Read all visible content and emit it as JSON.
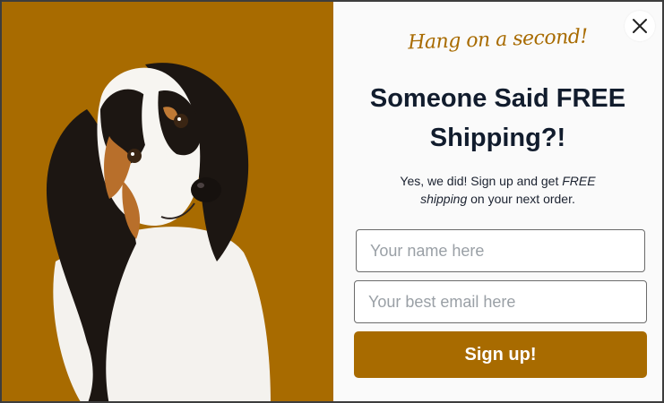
{
  "kicker": "Hang on a second!",
  "headline": "Someone Said FREE Shipping?!",
  "subtext": {
    "prefix": "Yes, we did! Sign up and get ",
    "emphasis": "FREE shipping",
    "suffix": " on your next order."
  },
  "form": {
    "name_placeholder": "Your name here",
    "email_placeholder": "Your best email here",
    "submit_label": "Sign up!"
  },
  "close_icon": "close-x",
  "image": "dog-photo",
  "colors": {
    "accent": "#a86b00",
    "heading": "#111c2d",
    "panel_bg": "#fafafa"
  }
}
